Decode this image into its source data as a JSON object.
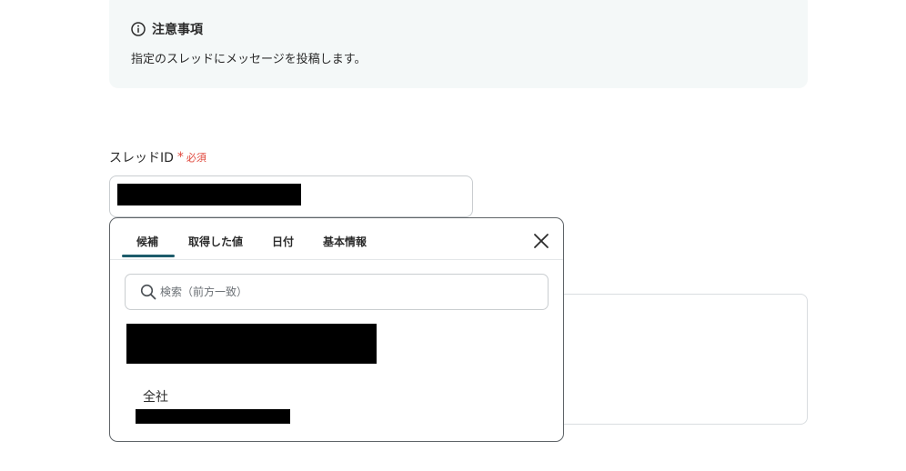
{
  "notice": {
    "title": "注意事項",
    "text": "指定のスレッドにメッセージを投稿します。"
  },
  "field": {
    "label": "スレッドID",
    "asterisk": "*",
    "required": "必須"
  },
  "popup": {
    "tabs": [
      "候補",
      "取得した値",
      "日付",
      "基本情報"
    ],
    "active_tab": "候補",
    "search_placeholder": "検索（前方一致）",
    "option_label": "全社"
  },
  "colors": {
    "accent": "#1d5c6b",
    "required": "#e0463a",
    "notice_bg": "#f4f8f8"
  }
}
